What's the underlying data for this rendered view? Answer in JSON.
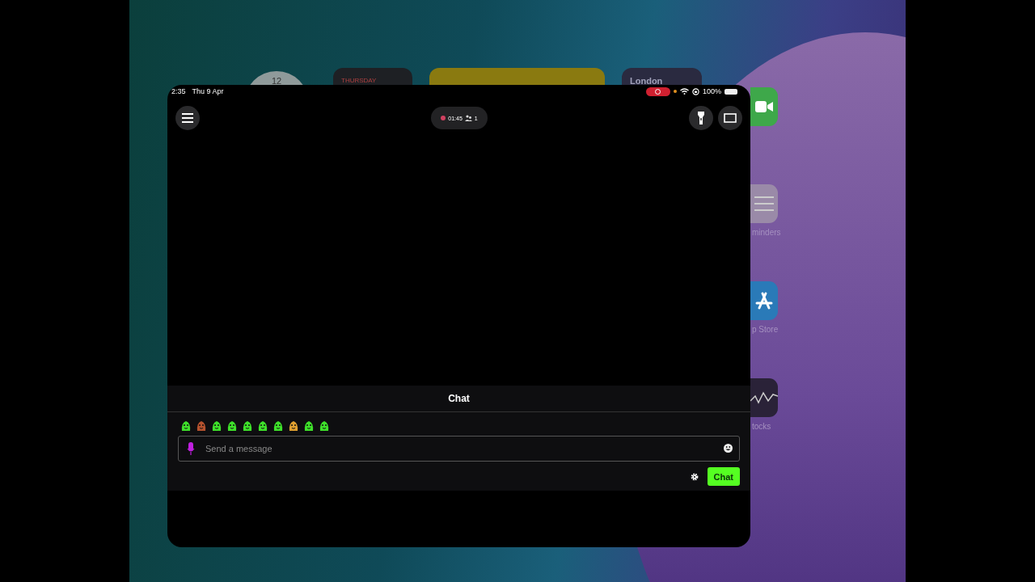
{
  "home_screen": {
    "clock_widget": {
      "numeral": "12"
    },
    "calendar_widget": {
      "day": "THURSDAY"
    },
    "weather_widget": {
      "city": "London"
    },
    "apps": [
      {
        "kind": "video"
      },
      {
        "kind": "list",
        "label": "minders"
      },
      {
        "kind": "store",
        "label": "p Store"
      },
      {
        "kind": "chart",
        "label": "tocks"
      }
    ]
  },
  "status_bar": {
    "time": "2:35",
    "date": "Thu 9 Apr",
    "screen_recording": true,
    "battery": "100%"
  },
  "app": {
    "live_badge": {
      "timer": "01:45",
      "viewers": "1"
    },
    "chat": {
      "title": "Chat",
      "input": {
        "placeholder": "Send a message"
      },
      "send_button": "Chat"
    }
  }
}
